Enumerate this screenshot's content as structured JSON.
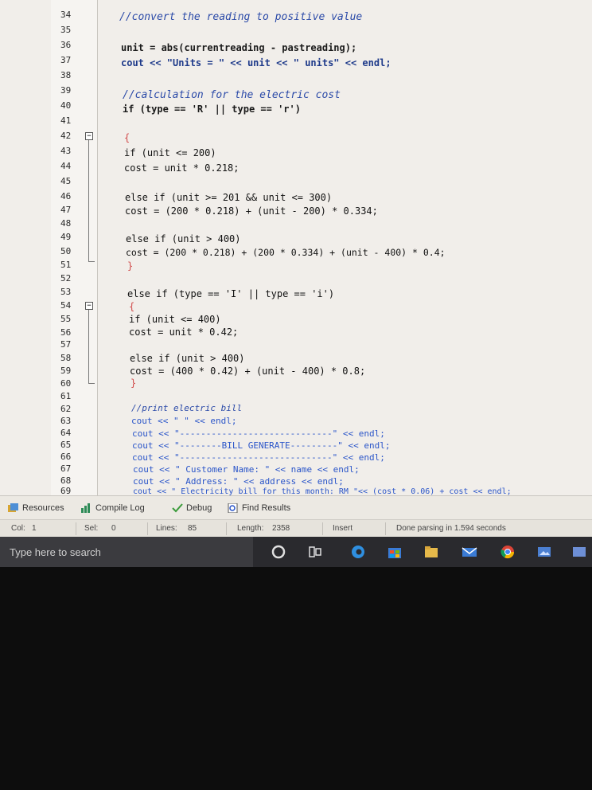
{
  "gutter": {
    "line_numbers": [
      "34",
      "35",
      "36",
      "37",
      "38",
      "39",
      "40",
      "41",
      "42",
      "43",
      "44",
      "45",
      "46",
      "47",
      "48",
      "49",
      "50",
      "51",
      "52",
      "53",
      "54",
      "55",
      "56",
      "57",
      "58",
      "59",
      "60",
      "61",
      "62",
      "63",
      "64",
      "65",
      "66",
      "67",
      "68",
      "69"
    ]
  },
  "code_lines": [
    "//convert the reading to positive value",
    "",
    "unit = abs(currentreading - pastreading);",
    "cout << \"Units = \" << unit << \" units\" << endl;",
    "",
    "//calculation for the electric cost",
    "if (type == 'R' || type == 'r')",
    "",
    "{",
    "if (unit <= 200)",
    "cost = unit * 0.218;",
    "",
    "else if (unit >= 201 && unit <= 300)",
    "cost = (200 * 0.218) + (unit - 200) * 0.334;",
    "",
    "else if (unit > 400)",
    "cost = (200 * 0.218) + (200 * 0.334) + (unit - 400) * 0.4;",
    "}",
    "",
    "else if (type == 'I' || type == 'i')",
    "{",
    "if (unit <= 400)",
    "cost = unit * 0.42;",
    "",
    "else if (unit > 400)",
    "cost = (400 * 0.42) + (unit - 400) * 0.8;",
    "}",
    "",
    "//print electric bill",
    "cout << \" \" << endl;",
    "cout << \"-----------------------------\" << endl;",
    "cout << \"--------BILL GENERATE---------\" << endl;",
    "cout << \"-----------------------------\" << endl;",
    "cout << \" Customer Name: \" << name << endl;",
    "cout << \" Address: \" << address << endl;",
    "cout << \" Electricity bill for this month: RM \"<< (cost * 0.06) + cost << endl;"
  ],
  "bottom_tabs": [
    {
      "label": "Resources",
      "icon": "resources-icon"
    },
    {
      "label": "Compile Log",
      "icon": "compile-log-icon"
    },
    {
      "label": "Debug",
      "icon": "debug-check-icon"
    },
    {
      "label": "Find Results",
      "icon": "find-results-icon"
    }
  ],
  "status": {
    "col_label": "Col:",
    "col_value": "1",
    "sel_label": "Sel:",
    "sel_value": "0",
    "lines_label": "Lines:",
    "lines_value": "85",
    "length_label": "Length:",
    "length_value": "2358",
    "mode": "Insert",
    "message": "Done parsing in 1.594 seconds"
  },
  "taskbar": {
    "search_placeholder": "Type here to search",
    "icons": [
      "cortana-icon",
      "task-view-icon",
      "edge-icon",
      "store-icon",
      "file-explorer-icon",
      "mail-icon",
      "chrome-icon",
      "photos-icon",
      "app-icon"
    ]
  },
  "colors": {
    "editor_bg": "#f1eeea",
    "comment": "#2b4aa8",
    "operator": "#d14a4a",
    "taskbar_bg": "#2a2a2e"
  }
}
